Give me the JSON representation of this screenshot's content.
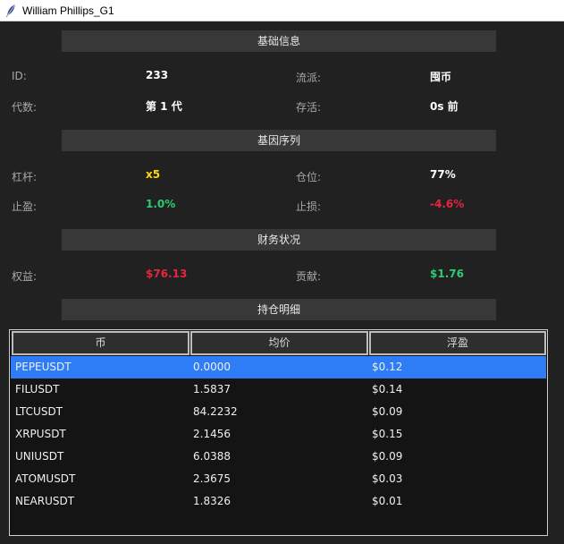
{
  "window": {
    "title": "William Phillips_G1"
  },
  "sections": {
    "basic": "基础信息",
    "gene": "基因序列",
    "finance": "财务状况",
    "positions": "持仓明细"
  },
  "basic": {
    "id_label": "ID:",
    "id_value": "233",
    "school_label": "流派:",
    "school_value": "囤币",
    "gen_label": "代数:",
    "gen_value": "第 1 代",
    "alive_label": "存活:",
    "alive_value": "0s 前"
  },
  "gene": {
    "leverage_label": "杠杆:",
    "leverage_value": "x5",
    "position_label": "仓位:",
    "position_value": "77%",
    "tp_label": "止盈:",
    "tp_value": "1.0%",
    "sl_label": "止损:",
    "sl_value": "-4.6%"
  },
  "finance": {
    "equity_label": "权益:",
    "equity_value": "$76.13",
    "contrib_label": "贡献:",
    "contrib_value": "$1.76"
  },
  "table": {
    "columns": [
      "币",
      "均价",
      "浮盈"
    ],
    "rows": [
      {
        "coin": "PEPEUSDT",
        "price": "0.0000",
        "pnl": "$0.12",
        "selected": true
      },
      {
        "coin": "FILUSDT",
        "price": "1.5837",
        "pnl": "$0.14",
        "selected": false
      },
      {
        "coin": "LTCUSDT",
        "price": "84.2232",
        "pnl": "$0.09",
        "selected": false
      },
      {
        "coin": "XRPUSDT",
        "price": "2.1456",
        "pnl": "$0.15",
        "selected": false
      },
      {
        "coin": "UNIUSDT",
        "price": "6.0388",
        "pnl": "$0.09",
        "selected": false
      },
      {
        "coin": "ATOMUSDT",
        "price": "2.3675",
        "pnl": "$0.03",
        "selected": false
      },
      {
        "coin": "NEARUSDT",
        "price": "1.8326",
        "pnl": "$0.01",
        "selected": false
      }
    ]
  },
  "colors": {
    "background": "#212121",
    "section_header": "#383838",
    "selection": "#2e7cf6",
    "positive": "#2ecc71",
    "negative": "#e8243e",
    "highlight": "#ffd60a"
  }
}
